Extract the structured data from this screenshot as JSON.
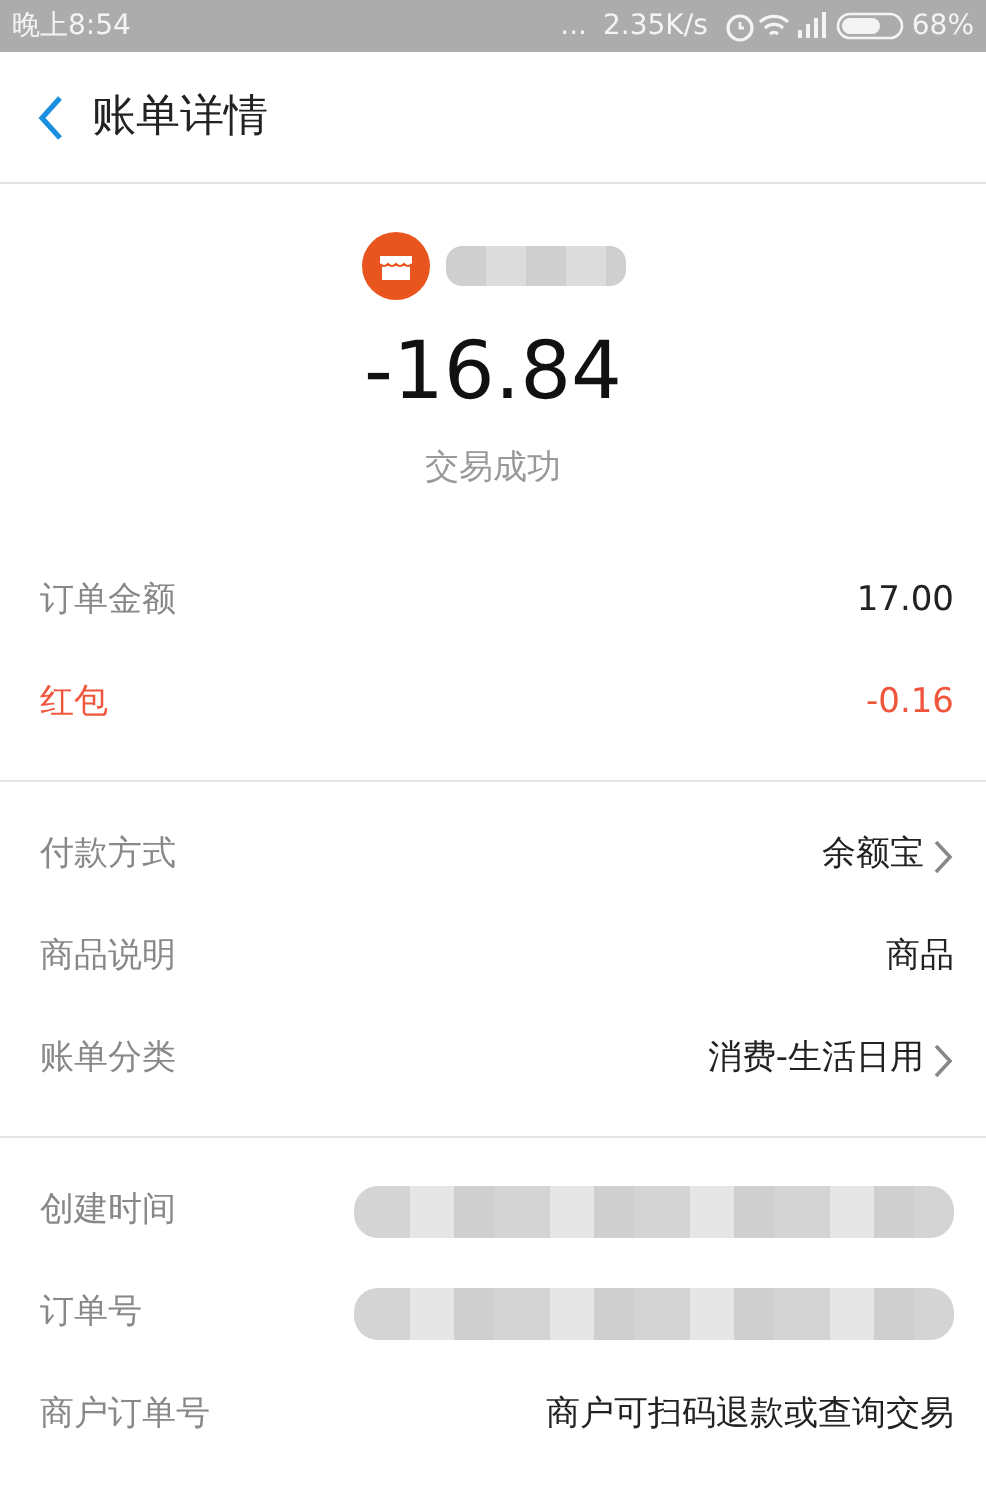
{
  "status_bar": {
    "time": "晚上8:54",
    "dots": "...",
    "network_speed": "2.35K/s",
    "battery": "68%"
  },
  "header": {
    "title": "账单详情"
  },
  "summary": {
    "amount": "-16.84",
    "status": "交易成功"
  },
  "sections": [
    [
      {
        "label": "订单金额",
        "value": "17.00",
        "kind": "plain",
        "link": false
      },
      {
        "label": "红包",
        "value": "-0.16",
        "kind": "discount",
        "link": false
      }
    ],
    [
      {
        "label": "付款方式",
        "value": "余额宝",
        "kind": "plain",
        "link": true
      },
      {
        "label": "商品说明",
        "value": "商品",
        "kind": "plain",
        "link": false
      },
      {
        "label": "账单分类",
        "value": "消费-生活日用",
        "kind": "plain",
        "link": true
      }
    ],
    [
      {
        "label": "创建时间",
        "kind": "redacted",
        "link": false
      },
      {
        "label": "订单号",
        "kind": "redacted",
        "link": false
      },
      {
        "label": "商户订单号",
        "value": "商户可扫码退款或查询交易",
        "kind": "plain",
        "link": false
      }
    ]
  ]
}
